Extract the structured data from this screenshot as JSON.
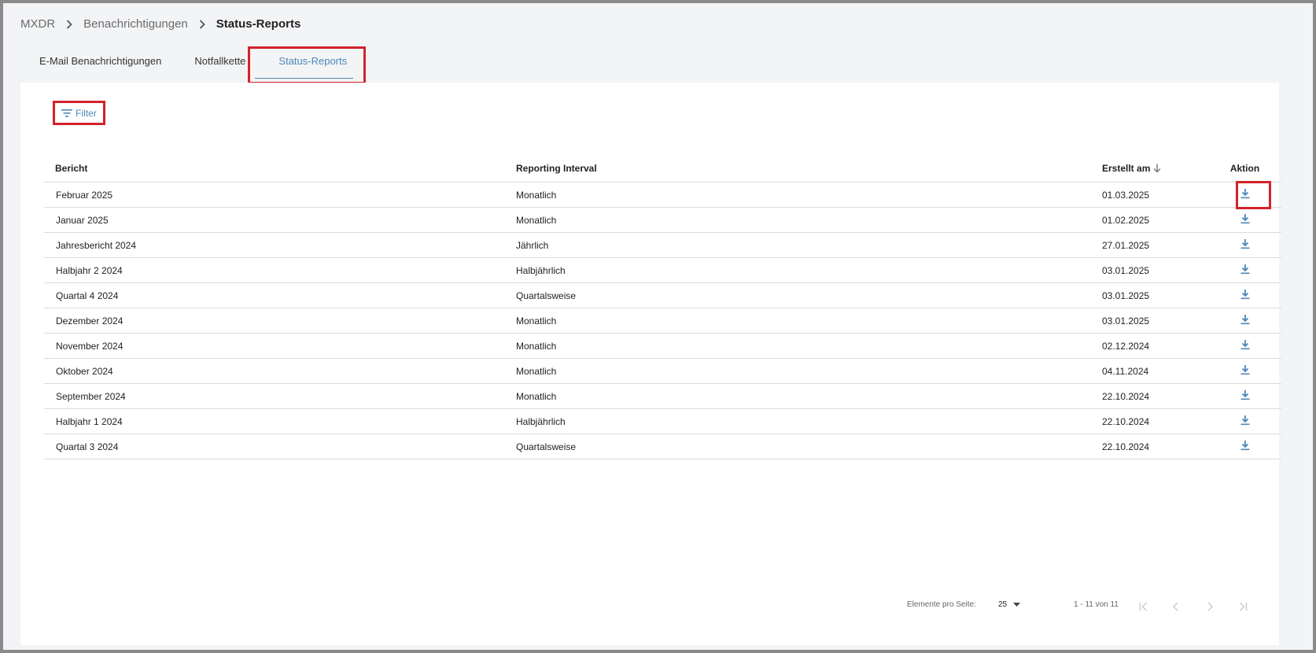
{
  "breadcrumb": {
    "items": [
      "MXDR",
      "Benachrichtigungen"
    ],
    "current": "Status-Reports"
  },
  "tabs": [
    {
      "label": "E-Mail Benachrichtigungen"
    },
    {
      "label": "Notfallkette"
    },
    {
      "label": "Status-Reports"
    }
  ],
  "filter": {
    "label": "Filter",
    "icon": "filter-icon"
  },
  "table": {
    "headers": {
      "bericht": "Bericht",
      "interval": "Reporting Interval",
      "erstellt": "Erstellt am",
      "aktion": "Aktion"
    },
    "rows": [
      {
        "bericht": "Februar 2025",
        "interval": "Monatlich",
        "erstellt": "01.03.2025"
      },
      {
        "bericht": "Januar 2025",
        "interval": "Monatlich",
        "erstellt": "01.02.2025"
      },
      {
        "bericht": "Jahresbericht 2024",
        "interval": "Jährlich",
        "erstellt": "27.01.2025"
      },
      {
        "bericht": "Halbjahr 2 2024",
        "interval": "Halbjährlich",
        "erstellt": "03.01.2025"
      },
      {
        "bericht": "Quartal 4 2024",
        "interval": "Quartalsweise",
        "erstellt": "03.01.2025"
      },
      {
        "bericht": "Dezember 2024",
        "interval": "Monatlich",
        "erstellt": "03.01.2025"
      },
      {
        "bericht": "November 2024",
        "interval": "Monatlich",
        "erstellt": "02.12.2024"
      },
      {
        "bericht": "Oktober 2024",
        "interval": "Monatlich",
        "erstellt": "04.11.2024"
      },
      {
        "bericht": "September 2024",
        "interval": "Monatlich",
        "erstellt": "22.10.2024"
      },
      {
        "bericht": "Halbjahr 1 2024",
        "interval": "Halbjährlich",
        "erstellt": "22.10.2024"
      },
      {
        "bericht": "Quartal 3 2024",
        "interval": "Quartalsweise",
        "erstellt": "22.10.2024"
      }
    ]
  },
  "pagination": {
    "per_page_label": "Elemente pro Seite:",
    "per_page_value": "25",
    "range": "1 - 11 von 11"
  },
  "colors": {
    "accent": "#4d87b8",
    "highlight": "#d2232a"
  }
}
